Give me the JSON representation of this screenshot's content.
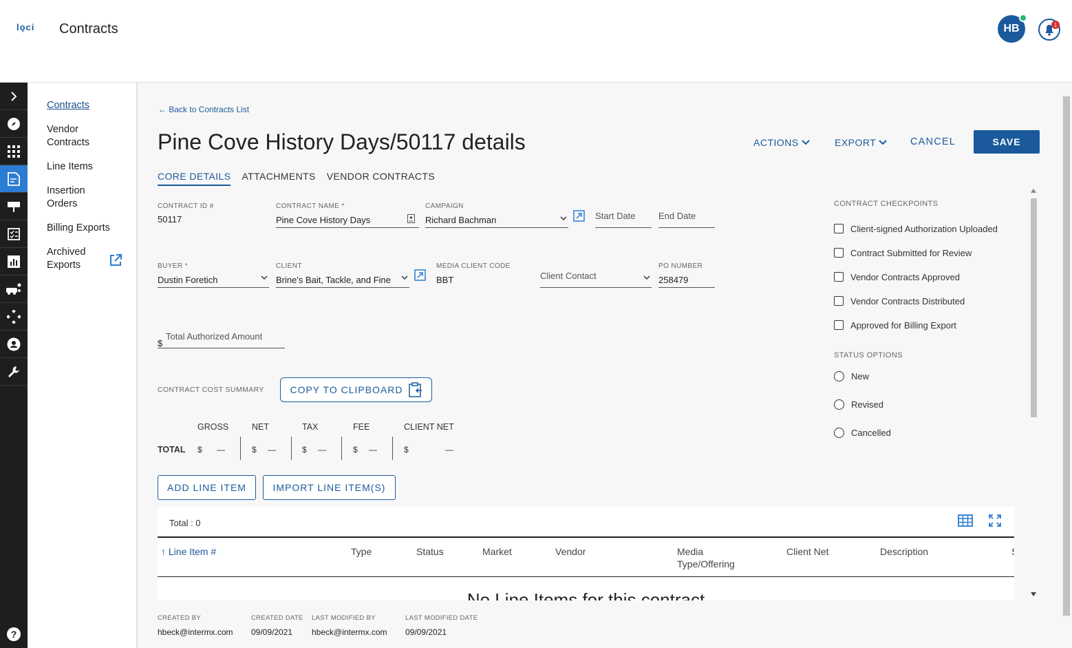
{
  "header": {
    "logo": "lǫci",
    "app_title": "Contracts",
    "avatar_initials": "HB",
    "notification_count": "1"
  },
  "subnav": {
    "items": [
      "Contracts",
      "Vendor Contracts",
      "Line Items",
      "Insertion Orders",
      "Billing Exports",
      "Archived Exports"
    ]
  },
  "page": {
    "back_link": "Back to Contracts List",
    "title": "Pine Cove History Days/50117 details",
    "actions_label": "ACTIONS",
    "export_label": "EXPORT",
    "cancel_label": "CANCEL",
    "save_label": "SAVE"
  },
  "tabs": [
    "CORE DETAILS",
    "ATTACHMENTS",
    "VENDOR CONTRACTS"
  ],
  "fields": {
    "contract_id": {
      "label": "CONTRACT ID #",
      "value": "50117"
    },
    "contract_name": {
      "label": "CONTRACT NAME *",
      "value": "Pine Cove History Days"
    },
    "campaign": {
      "label": "CAMPAIGN",
      "value": "Richard Bachman"
    },
    "start_date": {
      "placeholder": "Start Date"
    },
    "end_date": {
      "placeholder": "End Date"
    },
    "buyer": {
      "label": "BUYER *",
      "value": "Dustin Foretich"
    },
    "client": {
      "label": "CLIENT",
      "value": "Brine's Bait, Tackle, and Fine"
    },
    "media_client_code": {
      "label": "MEDIA CLIENT CODE",
      "value": "BBT"
    },
    "client_contact": {
      "placeholder": "Client Contact"
    },
    "po_number": {
      "label": "PO NUMBER",
      "value": "258479"
    },
    "total_authorized": {
      "prefix": "$",
      "placeholder": "Total Authorized Amount"
    }
  },
  "checkpoints": {
    "title": "CONTRACT CHECKPOINTS",
    "items": [
      "Client-signed Authorization Uploaded",
      "Contract Submitted for Review",
      "Vendor Contracts Approved",
      "Vendor Contracts Distributed",
      "Approved for Billing Export"
    ]
  },
  "status_options": {
    "title": "STATUS OPTIONS",
    "items": [
      "New",
      "Revised",
      "Cancelled"
    ]
  },
  "cost_summary": {
    "label": "CONTRACT COST SUMMARY",
    "copy_label": "COPY TO CLIPBOARD",
    "row_label": "TOTAL",
    "currency": "$",
    "empty": "—",
    "columns": [
      "GROSS",
      "NET",
      "TAX",
      "FEE",
      "CLIENT NET"
    ]
  },
  "line_items": {
    "add_label": "ADD LINE ITEM",
    "import_label": "IMPORT LINE ITEM(S)",
    "total_text": "Total : 0",
    "columns": [
      "Line Item #",
      "Type",
      "Status",
      "Market",
      "Vendor",
      "Media Type/Offering",
      "Client Net",
      "Description",
      "S"
    ],
    "empty_message": "No Line Items for this contract"
  },
  "meta": {
    "created_by": {
      "label": "CREATED BY",
      "value": "hbeck@intermx.com"
    },
    "created_date": {
      "label": "CREATED DATE",
      "value": "09/09/2021"
    },
    "last_modified_by": {
      "label": "LAST MODIFIED BY",
      "value": "hbeck@intermx.com"
    },
    "last_modified_date": {
      "label": "LAST MODIFIED DATE",
      "value": "09/09/2021"
    }
  },
  "colors": {
    "primary": "#1a5a9c",
    "rail": "#1e1e1e",
    "rail_active": "#2b7cd3",
    "online": "#2bb673",
    "badge": "#d32f2f"
  }
}
